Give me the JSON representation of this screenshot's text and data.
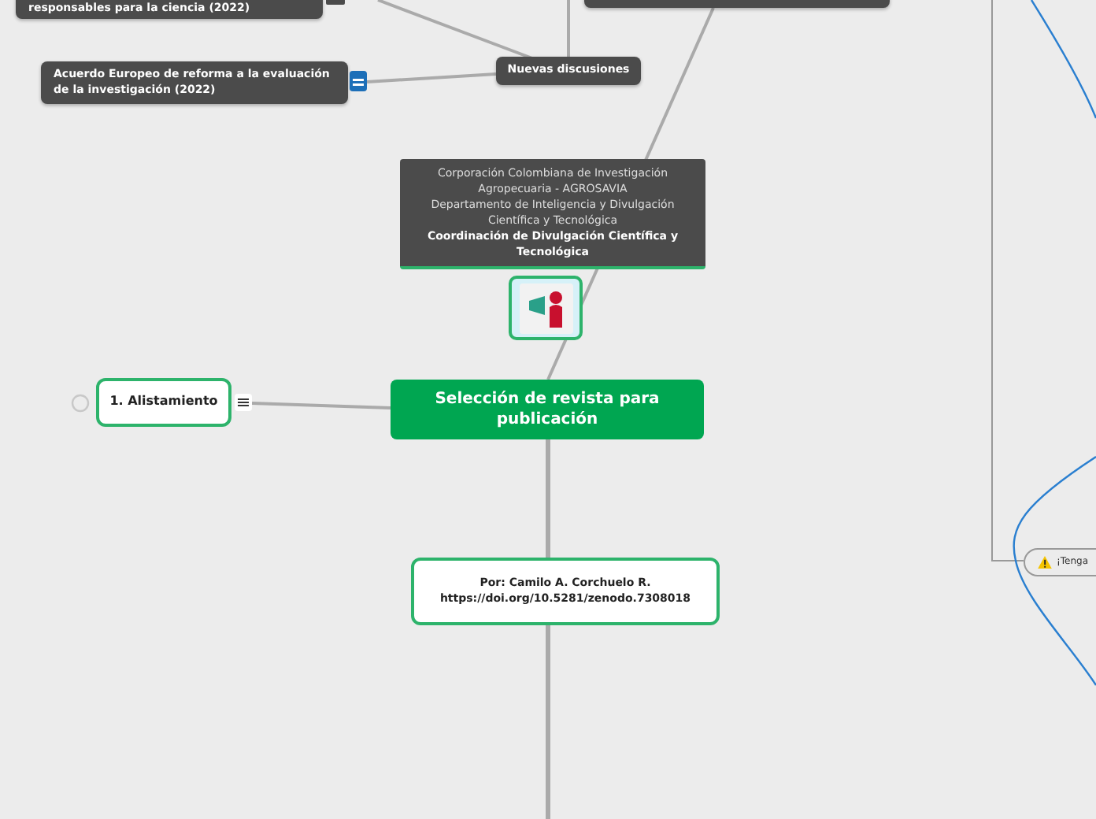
{
  "topics": [
    {
      "kind": "dark",
      "text": "responsables para la ciencia (2022)"
    },
    {
      "kind": "dark"
    },
    {
      "kind": "dark",
      "text": "Acuerdo Europeo de reforma a la evaluación de la investigación (2022)"
    },
    {
      "kind": "dark",
      "text": "Nuevas discusiones"
    },
    {
      "kind": "outline",
      "text": "1. Alistamiento"
    },
    {
      "kind": "main",
      "text": "Selección de revista para publicación"
    },
    {
      "kind": "outline",
      "text": "Por: Camilo A. Corchuelo R.\nhttps://doi.org/10.5281/zenodo.7308018"
    },
    {
      "kind": "pill",
      "text": "¡Tenga"
    }
  ],
  "info": {
    "lines": [
      "Corporación Colombiana de Investigación Agropecuaria - AGROSAVIA",
      "Departamento de Inteligencia y Divulgación Científica y Tecnológica"
    ],
    "bold_line": "Coordinación de Divulgación Científica y Tecnológica"
  }
}
